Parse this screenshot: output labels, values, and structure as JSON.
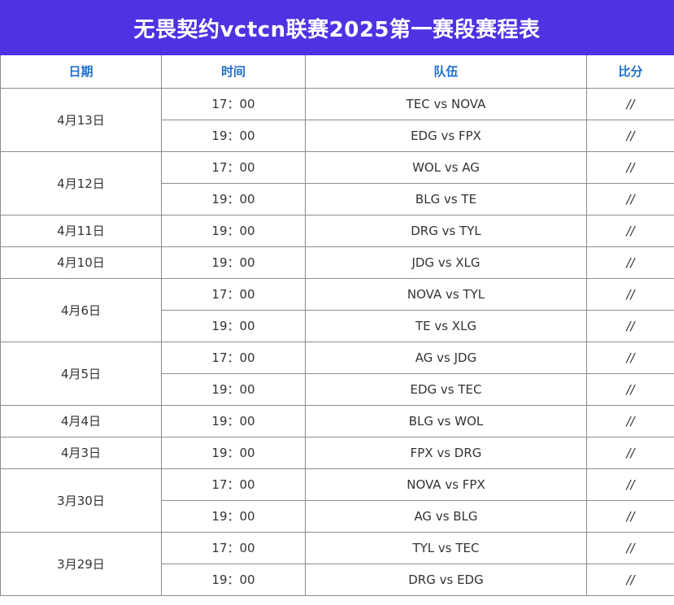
{
  "title": "无畏契约vctcn联赛2025第一赛段赛程表",
  "colors": {
    "title_bg": "#4f33e3",
    "header_text": "#1f6fd1",
    "border": "#8c8c8c"
  },
  "headers": {
    "date": "日期",
    "time": "时间",
    "team": "队伍",
    "score": "比分"
  },
  "days": [
    {
      "date": "4月13日",
      "matches": [
        {
          "time": "17：00",
          "teams": "TEC vs NOVA",
          "score": "//"
        },
        {
          "time": "19：00",
          "teams": "EDG vs FPX",
          "score": "//"
        }
      ]
    },
    {
      "date": "4月12日",
      "matches": [
        {
          "time": "17：00",
          "teams": "WOL vs AG",
          "score": "//"
        },
        {
          "time": "19：00",
          "teams": "BLG vs TE",
          "score": "//"
        }
      ]
    },
    {
      "date": "4月11日",
      "matches": [
        {
          "time": "19：00",
          "teams": "DRG vs TYL",
          "score": "//"
        }
      ]
    },
    {
      "date": "4月10日",
      "matches": [
        {
          "time": "19：00",
          "teams": "JDG vs XLG",
          "score": "//"
        }
      ]
    },
    {
      "date": "4月6日",
      "matches": [
        {
          "time": "17：00",
          "teams": "NOVA vs TYL",
          "score": "//"
        },
        {
          "time": "19：00",
          "teams": "TE vs XLG",
          "score": "//"
        }
      ]
    },
    {
      "date": "4月5日",
      "matches": [
        {
          "time": "17：00",
          "teams": "AG vs JDG",
          "score": "//"
        },
        {
          "time": "19：00",
          "teams": "EDG vs TEC",
          "score": "//"
        }
      ]
    },
    {
      "date": "4月4日",
      "matches": [
        {
          "time": "19：00",
          "teams": "BLG vs WOL",
          "score": "//"
        }
      ]
    },
    {
      "date": "4月3日",
      "matches": [
        {
          "time": "19：00",
          "teams": "FPX vs DRG",
          "score": "//"
        }
      ]
    },
    {
      "date": "3月30日",
      "matches": [
        {
          "time": "17：00",
          "teams": "NOVA vs FPX",
          "score": "//"
        },
        {
          "time": "19：00",
          "teams": "AG vs BLG",
          "score": "//"
        }
      ]
    },
    {
      "date": "3月29日",
      "matches": [
        {
          "time": "17：00",
          "teams": "TYL vs TEC",
          "score": "//"
        },
        {
          "time": "19：00",
          "teams": "DRG vs EDG",
          "score": "//"
        }
      ]
    }
  ]
}
